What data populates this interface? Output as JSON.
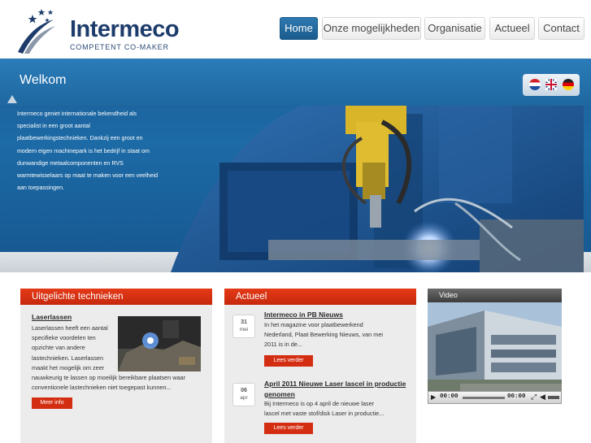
{
  "header": {
    "brand_name": "Intermeco",
    "brand_tagline": "COMPETENT CO-MAKER",
    "nav": [
      {
        "label": "Home",
        "active": true
      },
      {
        "label": "Onze mogelijkheden",
        "active": false
      },
      {
        "label": "Organisatie",
        "active": false
      },
      {
        "label": "Actueel",
        "active": false
      },
      {
        "label": "Contact",
        "active": false
      }
    ]
  },
  "hero": {
    "title": "Welkom",
    "lines": [
      "Intermeco geniet internationale bekendheid als",
      "specialist in een groot aantal",
      "plaatbewerkingstechnieken. Dankzij een groot en",
      "modern eigen machinepark is het bedrijf in staat om",
      "dunwandige metaalcomponenten en RVS",
      "warmtewisselaars op maat te maken voor een veelheid",
      "aan toepassingen."
    ],
    "flags": [
      "nl-flag-icon",
      "uk-flag-icon",
      "de-flag-icon"
    ]
  },
  "techniques": {
    "heading": "Uitgelichte technieken",
    "item_title": "Laserlassen",
    "lines": [
      "Laserlassen heeft een aantal",
      "specifieke voordelen ten",
      "opzichte van andere",
      "lastechnieken. Laserlassen",
      "maakt het mogelijk om zeer",
      "nauwkeurig te lassen op moeilijk bereikbare plaatsen waar",
      "conventionele lastechnieken niet toegepast kunnen..."
    ],
    "button": "Meer info"
  },
  "news": {
    "heading": "Actueel",
    "items": [
      {
        "day": "31",
        "month": "mei",
        "title": "Intermeco in PB Nieuws",
        "lines": [
          "In het magazine voor plaatbewerkend",
          "Nederland, Plaat Bewerking Nieuws, van mei",
          "2011 is in de..."
        ],
        "button": "Lees verder"
      },
      {
        "day": "06",
        "month": "apr",
        "title_lines": [
          "April 2011 Nieuwe Laser lascel in productie",
          "genomen"
        ],
        "lines": [
          "Bij Intermeco is op 4 april de nieuwe laser",
          "lascel met vaste stof/disk Laser in productie..."
        ],
        "button": "Lees verder"
      }
    ]
  },
  "video": {
    "heading": "Video",
    "time_current": "00:00",
    "time_total": "00:00"
  },
  "colors": {
    "brand_blue": "#1e3c6b",
    "nav_active": "#1a5b8c",
    "hero_blue": "#1c6aa6",
    "accent_red": "#d42e12",
    "panel_bg": "#ececec"
  }
}
